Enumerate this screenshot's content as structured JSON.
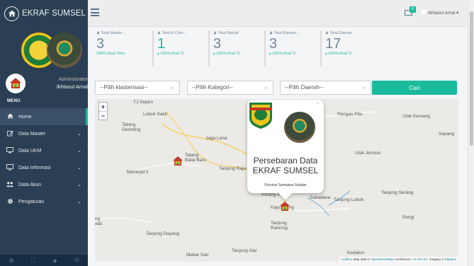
{
  "brand": {
    "name": "EKRAF SUMSEL",
    "icon": "home-icon"
  },
  "profile": {
    "role": "Administrator",
    "name": "Ikhlasul Amal"
  },
  "menu": {
    "title": "MENU",
    "items": [
      {
        "label": "Home",
        "icon": "home-icon",
        "active": true
      },
      {
        "label": "Data Master",
        "icon": "edit-icon"
      },
      {
        "label": "Data UKM",
        "icon": "desktop-icon"
      },
      {
        "label": "Data Informasi",
        "icon": "desktop-icon"
      },
      {
        "label": "Data Akun",
        "icon": "users-icon"
      },
      {
        "label": "Pengaturan",
        "icon": "gear-icon"
      }
    ]
  },
  "topbar": {
    "notifications": "8",
    "user": "Ikhlasul Amal"
  },
  "stats": [
    {
      "label": "Total Master ...",
      "value": "3",
      "sub": "100% Real Time"
    },
    {
      "label": "Total E-Com...",
      "value": "1",
      "sub": "100% Real Ti..."
    },
    {
      "label": "Total Bekraf",
      "value": "3",
      "sub": "100% Real Ti..."
    },
    {
      "label": "Total Klasteri...",
      "value": "3",
      "sub": "100% Real Ti..."
    },
    {
      "label": "Total Daerah",
      "value": "17",
      "sub": "100% Real Ti..."
    }
  ],
  "filters": {
    "klasterisasi": "--Pilih klasterisasi--",
    "kategori": "--Pilih Kategori--",
    "daerah": "--Pilih Daerah--",
    "search_button": "Cari"
  },
  "map": {
    "places": [
      "TJ Sejaro",
      "Lubuk Sakti",
      "Tebing Gerinting",
      "Jaga Lana",
      "Talang Balai Baru",
      "Meranjat Ii",
      "Tanjung Raja",
      "Rengas Pitu",
      "Ulak Kemang",
      "Sepang",
      "Ulak Jermun",
      "Tanjung Serang",
      "Pinang II",
      "Sukadana",
      "Tanjung Lubuk",
      "Kayuagung",
      "Perigi",
      "Tanjung Rancing",
      "ng",
      "elai",
      "Tanjung Dayang",
      "Tanjung Alai",
      "Mekar Sari",
      "Kedaton"
    ],
    "zoom_in": "+",
    "zoom_out": "−",
    "attribution": {
      "leaflet": "Leaflet",
      "text1": " | Map data © ",
      "osm": "OpenStreetMap",
      "text2": " contributors, ",
      "license": "CC-BY-SA",
      "text3": ", Imagery © ",
      "mapbox": "Mapbox"
    },
    "popup": {
      "title": "Persebaran Data EKRAF SUMSEL",
      "subtitle": "Provinsi Sumatera Selatan",
      "close": "×"
    }
  },
  "colors": {
    "sidebar": "#2a3f54",
    "accent": "#1abb9c"
  }
}
